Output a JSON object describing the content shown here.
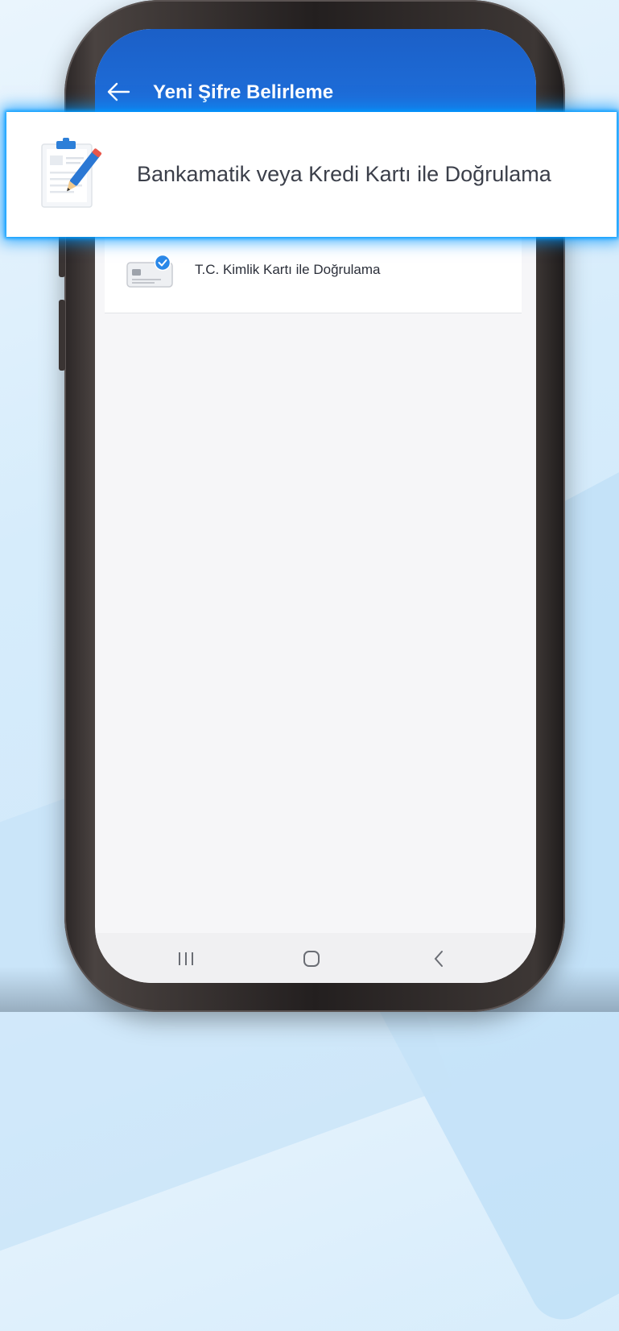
{
  "header": {
    "title": "Yeni Şifre Belirleme",
    "back_icon": "arrow-left-icon"
  },
  "options": [
    {
      "label": "Bankamatik veya Kredi Kartı ile Doğrulama",
      "icon": "clipboard-pencil-icon",
      "highlighted": true
    },
    {
      "label": "T.C. Kimlik Kartı ile Doğrulama",
      "icon": "id-card-check-icon",
      "highlighted": false
    }
  ],
  "navbar": {
    "recent_icon": "recent-apps-icon",
    "home_icon": "home-icon",
    "back_icon": "back-chevron-icon"
  },
  "colors": {
    "header_blue": "#1f6fdc",
    "highlight_glow": "#0096ff",
    "check_blue": "#2a88e8"
  }
}
